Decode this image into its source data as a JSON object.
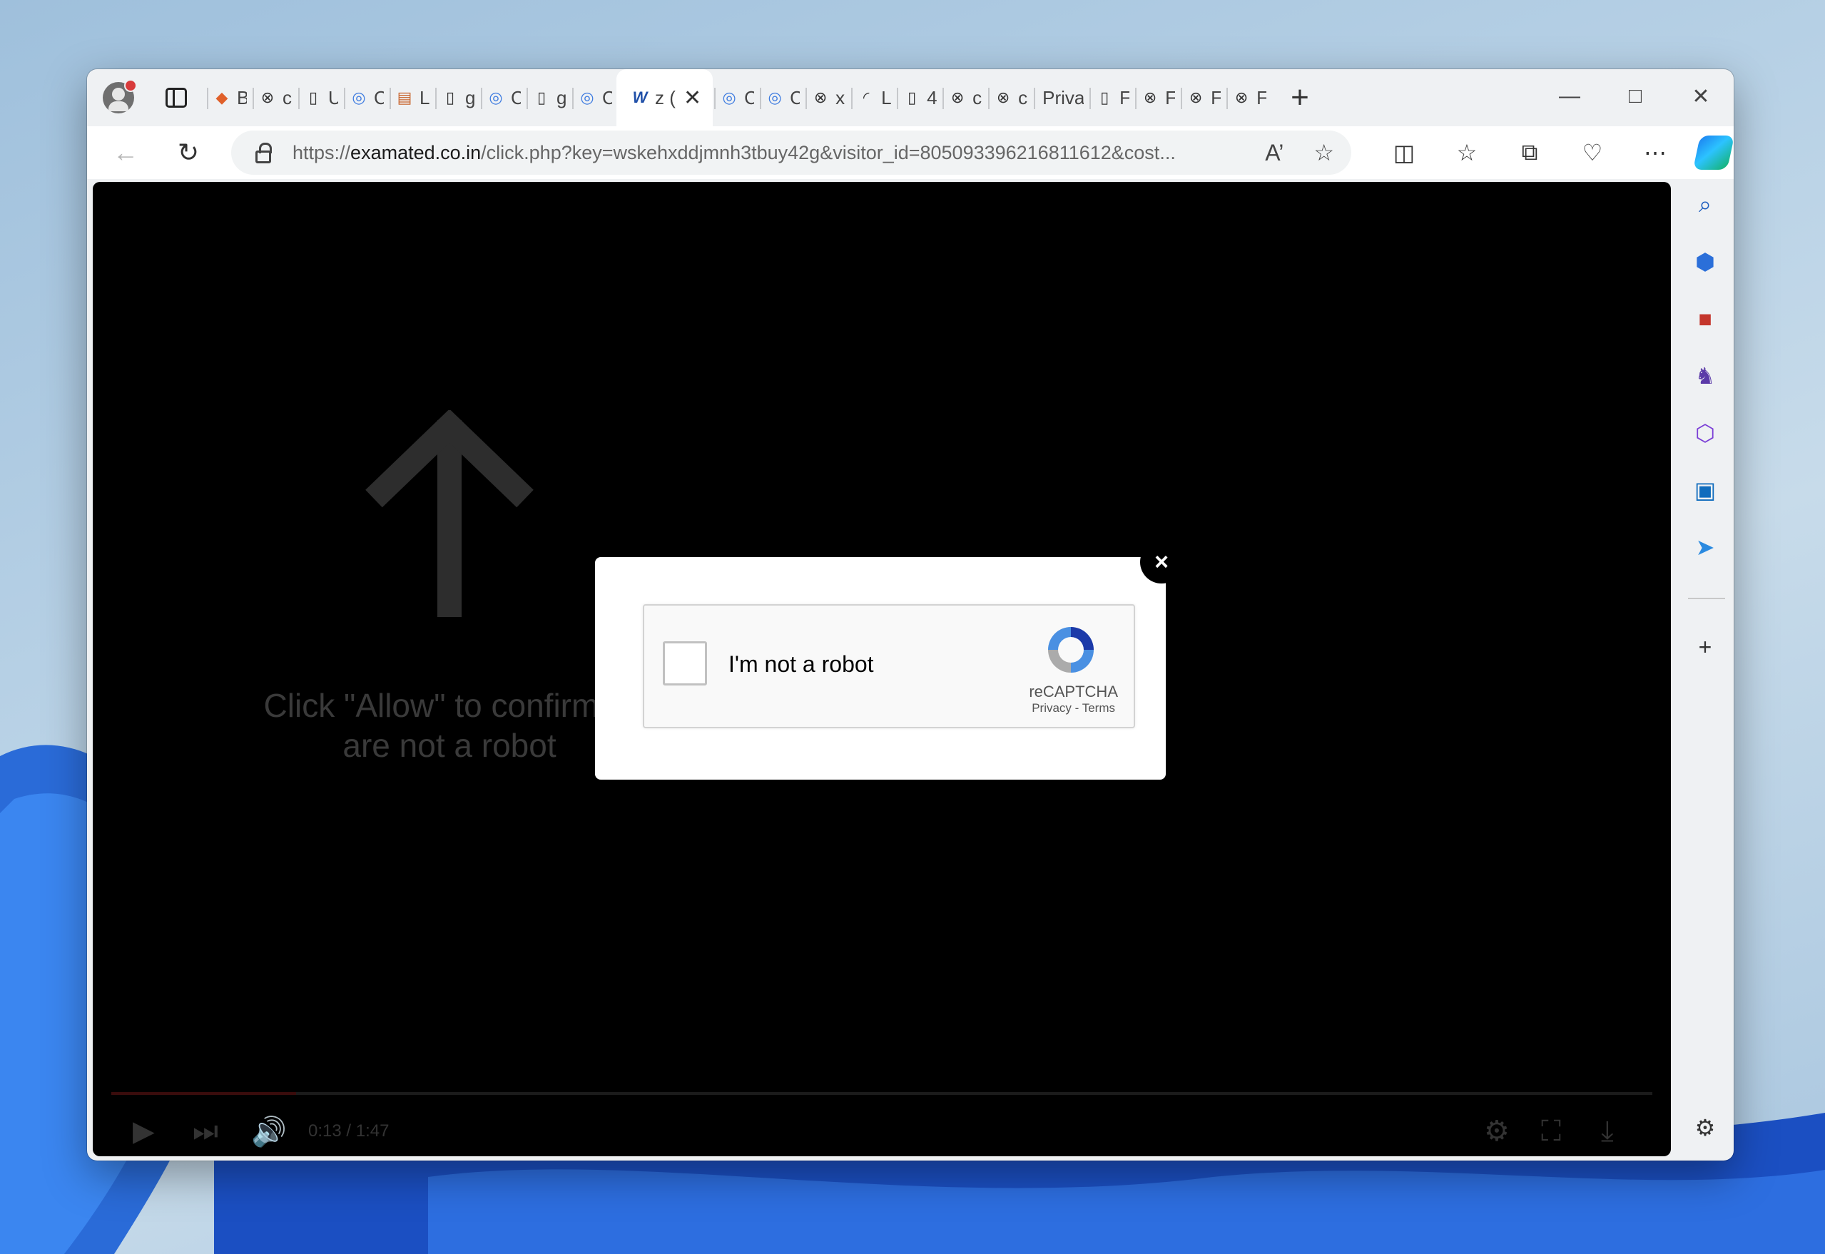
{
  "browser": {
    "tabs": [
      {
        "favicon": "brave-icon",
        "title": "B"
      },
      {
        "favicon": "error-page-icon",
        "title": "c"
      },
      {
        "favicon": "page-icon",
        "title": "U"
      },
      {
        "favicon": "network-icon",
        "title": "C"
      },
      {
        "favicon": "image-icon",
        "title": "L"
      },
      {
        "favicon": "page-icon",
        "title": "g"
      },
      {
        "favicon": "network-icon",
        "title": "C"
      },
      {
        "favicon": "page-icon",
        "title": "g"
      },
      {
        "favicon": "network-icon",
        "title": "C"
      },
      {
        "favicon": "w-logo-icon",
        "title": "z (",
        "active": true
      },
      {
        "favicon": "network-icon",
        "title": "C"
      },
      {
        "favicon": "network-icon",
        "title": "C"
      },
      {
        "favicon": "error-page-icon",
        "title": "x"
      },
      {
        "favicon": "spinner-icon",
        "title": "L"
      },
      {
        "favicon": "page-icon",
        "title": "4"
      },
      {
        "favicon": "error-page-icon",
        "title": "c"
      },
      {
        "favicon": "error-page-icon",
        "title": "c"
      },
      {
        "favicon": "none",
        "title": "Privac"
      },
      {
        "favicon": "page-icon",
        "title": "F"
      },
      {
        "favicon": "error-page-icon",
        "title": "F"
      },
      {
        "favicon": "error-page-icon",
        "title": "F"
      },
      {
        "favicon": "error-page-icon",
        "title": "F"
      }
    ],
    "url_prefix": "https://",
    "url_host": "examated.co.in",
    "url_path": "/click.php?key=wskehxddjmnh3tbuy42g&visitor_id=805093396216811612&cost..."
  },
  "page": {
    "overlay_text_line1": "Click \"Allow\" to confirm th",
    "overlay_text_line2": "are not a robot",
    "video_time": "0:13 / 1:47",
    "video_progress": 0.12
  },
  "captcha": {
    "label": "I'm not a robot",
    "brand": "reCAPTCHA",
    "links": "Privacy - Terms",
    "close_glyph": "×"
  },
  "colors": {
    "accent_blue": "#1a73e8",
    "recaptcha_blue": "#4a90e2"
  }
}
